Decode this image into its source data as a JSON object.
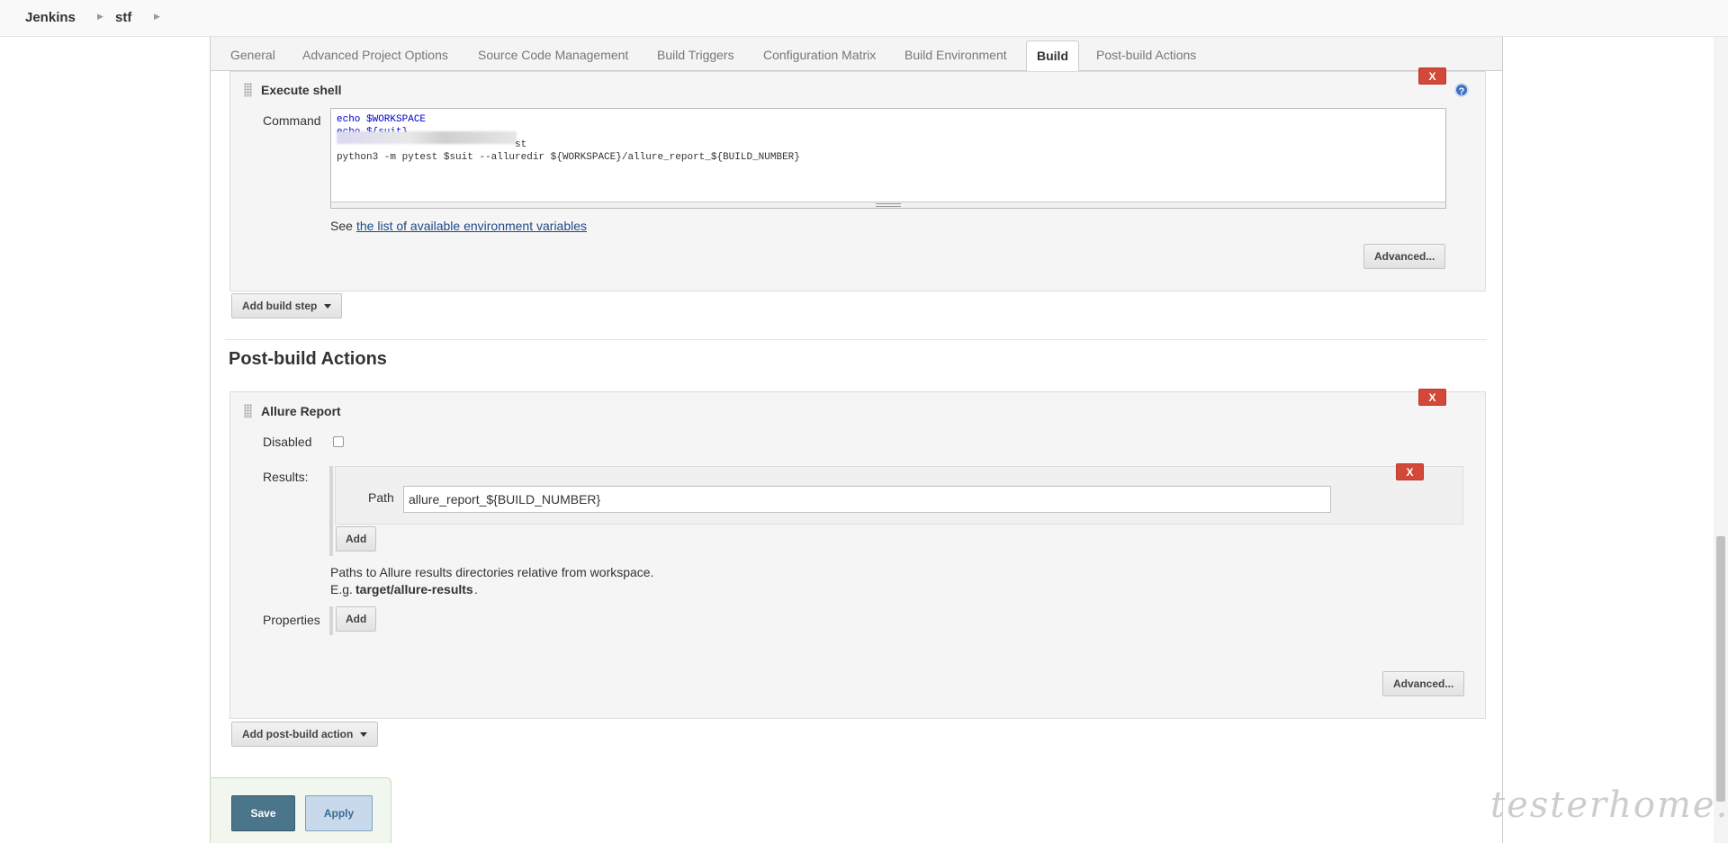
{
  "breadcrumb": {
    "home": "Jenkins",
    "project": "stf"
  },
  "tabs": [
    "General",
    "Advanced Project Options",
    "Source Code Management",
    "Build Triggers",
    "Configuration Matrix",
    "Build Environment",
    "Build",
    "Post-build Actions"
  ],
  "active_tab": "Build",
  "execute_shell": {
    "title": "Execute shell",
    "command_label": "Command",
    "lines": [
      "echo $WORKSPACE",
      "echo ${suit}",
      "                              st",
      "python3 -m pytest $suit --alluredir ${WORKSPACE}/allure_report_${BUILD_NUMBER}"
    ],
    "see_text": "See",
    "env_link": "the list of available environment variables",
    "advanced_label": "Advanced...",
    "delete_label": "X",
    "help_label": "?"
  },
  "add_build_step_label": "Add build step",
  "post_build": {
    "heading": "Post-build Actions",
    "allure": {
      "title": "Allure Report",
      "delete_label": "X",
      "disabled_label": "Disabled",
      "results_label": "Results:",
      "path_label": "Path",
      "path_value": "allure_report_${BUILD_NUMBER}",
      "path_delete_label": "X",
      "add_label": "Add",
      "hint_line1": "Paths to Allure results directories relative from workspace.",
      "hint_eg": "E.g.",
      "hint_example": "target/allure-results",
      "hint_period": ".",
      "properties_label": "Properties",
      "properties_add_label": "Add",
      "advanced_label": "Advanced..."
    },
    "add_post_build_label": "Add post-build action"
  },
  "save_label": "Save",
  "apply_label": "Apply",
  "watermark": "testerhome.com"
}
